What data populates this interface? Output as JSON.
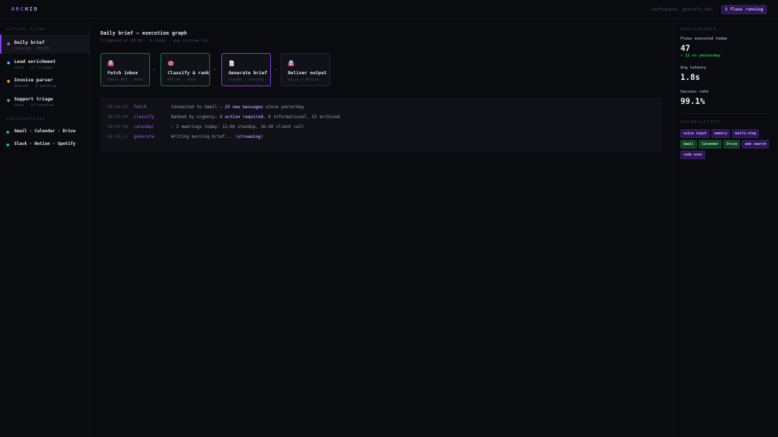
{
  "app": {
    "logo_a": "ORC",
    "logo_b": "HID",
    "workspace": "workspace: gonzalo_dev",
    "flows_running_badge": "3 flows running"
  },
  "sidebar": {
    "active_flows_label": "ACTIVE FLOWS",
    "flows": [
      {
        "name": "Daily brief",
        "sub": "running · 00:00",
        "color": "#a855f7"
      },
      {
        "name": "Lead enrichment",
        "sub": "idle · on trigger",
        "color": "#38bdf8"
      },
      {
        "name": "Invoice parser",
        "sub": "queued · 3 pending",
        "color": "#f59e0b"
      },
      {
        "name": "Support triage",
        "sub": "done · 14 handled",
        "color": "#22c55e"
      }
    ],
    "integrations_label": "INTEGRATIONS",
    "integrations": [
      {
        "name": "Gmail · Calendar · Drive"
      },
      {
        "name": "Slack · Notion · Spotify"
      }
    ]
  },
  "main": {
    "title": "Daily brief — execution graph",
    "subtitle": "Triggered at 08:00 · 4 steps · avg runtime 12s",
    "nodes": [
      {
        "title": "Fetch inbox",
        "sub": "Gmail API · done",
        "status": "done",
        "icon": "inbox-icon",
        "icon_color": "#d64d8a"
      },
      {
        "title": "Classify & rank",
        "sub": "GPT-4o · done",
        "status": "done",
        "icon": "brain-icon",
        "icon_color": "#e879b5"
      },
      {
        "title": "Generate brief",
        "sub": "Claude · running",
        "status": "running",
        "icon": "document-icon",
        "icon_color": "#e9e4f2"
      },
      {
        "title": "Deliver output",
        "sub": "Voice + Notion",
        "status": "pending",
        "icon": "outbox-icon",
        "icon_color": "#d64d8a"
      }
    ],
    "arrow": "→",
    "log": [
      {
        "time": "08:00:01",
        "step": "fetch",
        "pre": "Connected to Gmail — ",
        "hl": "23 new messages",
        "post": " since yesterday"
      },
      {
        "time": "08:00:04",
        "step": "classify",
        "pre": "Ranked by urgency: ",
        "hl": "3 action required",
        "post": ", 8 informational, 12 archived"
      },
      {
        "time": "08:00:08",
        "step": "calendar",
        "check": "✓",
        "pre": " 2 meetings today: 11:00 standup, 16:30 client call",
        "hl": "",
        "post": ""
      },
      {
        "time": "08:00:11",
        "step": "generate",
        "pre": "Writing morning brief... (",
        "hl": "streaming",
        "post": ")"
      }
    ]
  },
  "right": {
    "performance_label": "PERFORMANCE",
    "stats": [
      {
        "label": "Flows executed today",
        "value": "47",
        "delta": "↑ 12 vs yesterday"
      },
      {
        "label": "Avg latency",
        "value": "1.8s",
        "delta": ""
      },
      {
        "label": "Success rate",
        "value": "99.1%",
        "delta": ""
      }
    ],
    "capabilities_label": "CAPABILITIES",
    "capabilities": [
      {
        "label": "voice input",
        "tone": "purple"
      },
      {
        "label": "memory",
        "tone": "purple"
      },
      {
        "label": "multi-step",
        "tone": "purple"
      },
      {
        "label": "Gmail",
        "tone": "green"
      },
      {
        "label": "Calendar",
        "tone": "green"
      },
      {
        "label": "Drive",
        "tone": "green"
      },
      {
        "label": "web search",
        "tone": "purple"
      },
      {
        "label": "code exec",
        "tone": "purple"
      }
    ]
  },
  "colors": {
    "accent": "#8b3dff",
    "done": "#1f7a4d",
    "success": "#22c55e"
  }
}
